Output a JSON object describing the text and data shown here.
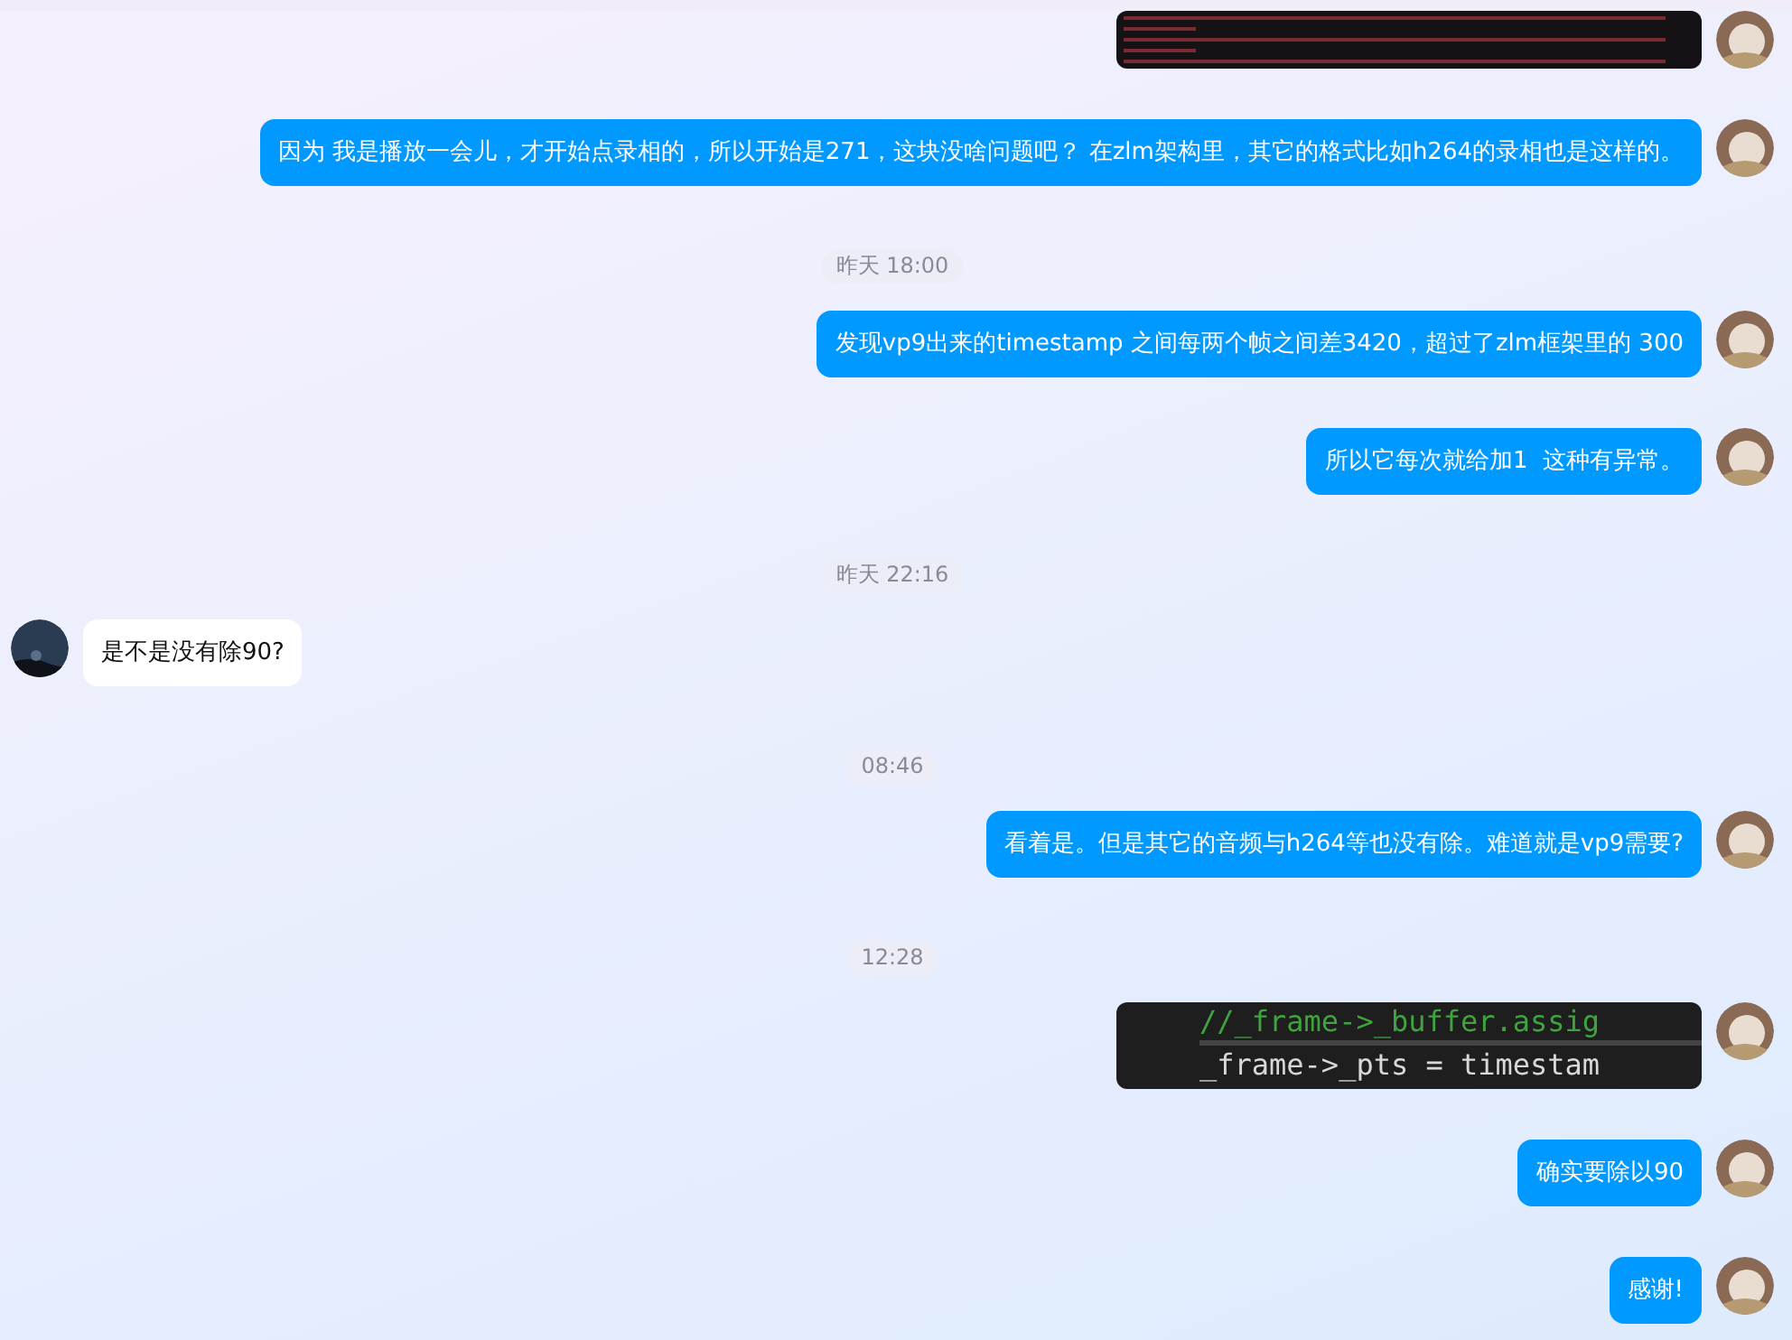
{
  "messages": [
    {
      "kind": "picture",
      "outgoing": true
    },
    {
      "kind": "text",
      "outgoing": true,
      "text": "因为 我是播放一会儿，才开始点录相的，所以开始是271，这块没啥问题吧？ 在zlm架构里，其它的格式比如h264的录相也是这样的。"
    },
    {
      "kind": "time",
      "text": "昨天 18:00"
    },
    {
      "kind": "text",
      "outgoing": true,
      "text": "发现vp9出来的timestamp 之间每两个帧之间差3420，超过了zlm框架里的 300"
    },
    {
      "kind": "text",
      "outgoing": true,
      "text": "所以它每次就给加1  这种有异常。"
    },
    {
      "kind": "time",
      "text": "昨天 22:16"
    },
    {
      "kind": "text",
      "outgoing": false,
      "text": "是不是没有除90?"
    },
    {
      "kind": "time",
      "text": "08:46"
    },
    {
      "kind": "text",
      "outgoing": true,
      "text": "看着是。但是其它的音频与h264等也没有除。难道就是vp9需要?"
    },
    {
      "kind": "time",
      "text": "12:28"
    },
    {
      "kind": "code",
      "outgoing": true,
      "lines": [
        "//_frame->_buffer.assig",
        "_frame->_pts = timestam"
      ]
    },
    {
      "kind": "text",
      "outgoing": true,
      "text": "确实要除以90"
    },
    {
      "kind": "text",
      "outgoing": true,
      "text": "感谢!"
    }
  ]
}
